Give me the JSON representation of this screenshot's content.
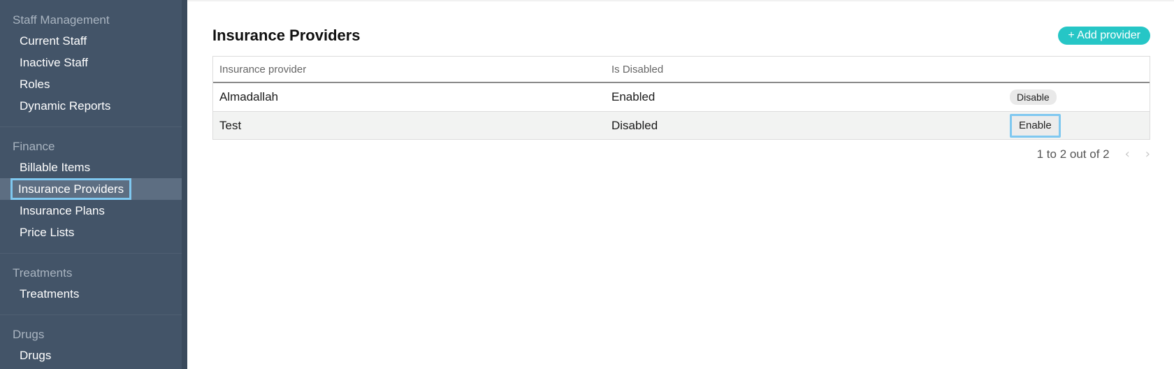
{
  "sidebar": {
    "sections": [
      {
        "title": "Staff Management",
        "items": [
          "Current Staff",
          "Inactive Staff",
          "Roles",
          "Dynamic Reports"
        ]
      },
      {
        "title": "Finance",
        "items": [
          "Billable Items",
          "Insurance Providers",
          "Insurance Plans",
          "Price Lists"
        ]
      },
      {
        "title": "Treatments",
        "items": [
          "Treatments"
        ]
      },
      {
        "title": "Drugs",
        "items": [
          "Drugs"
        ]
      }
    ],
    "active": "Insurance Providers"
  },
  "main": {
    "title": "Insurance Providers",
    "add_button": "+ Add provider",
    "table": {
      "headers": [
        "Insurance provider",
        "Is Disabled"
      ],
      "rows": [
        {
          "name": "Almadallah",
          "status": "Enabled",
          "action": "Disable"
        },
        {
          "name": "Test",
          "status": "Disabled",
          "action": "Enable"
        }
      ]
    },
    "pagination": {
      "summary": "1 to 2 out of 2",
      "prev_icon": "chevron-left-icon",
      "next_icon": "chevron-right-icon"
    }
  },
  "colors": {
    "sidebar": "#435468",
    "accent": "#26c6c6",
    "focus": "#7fc8f0"
  }
}
